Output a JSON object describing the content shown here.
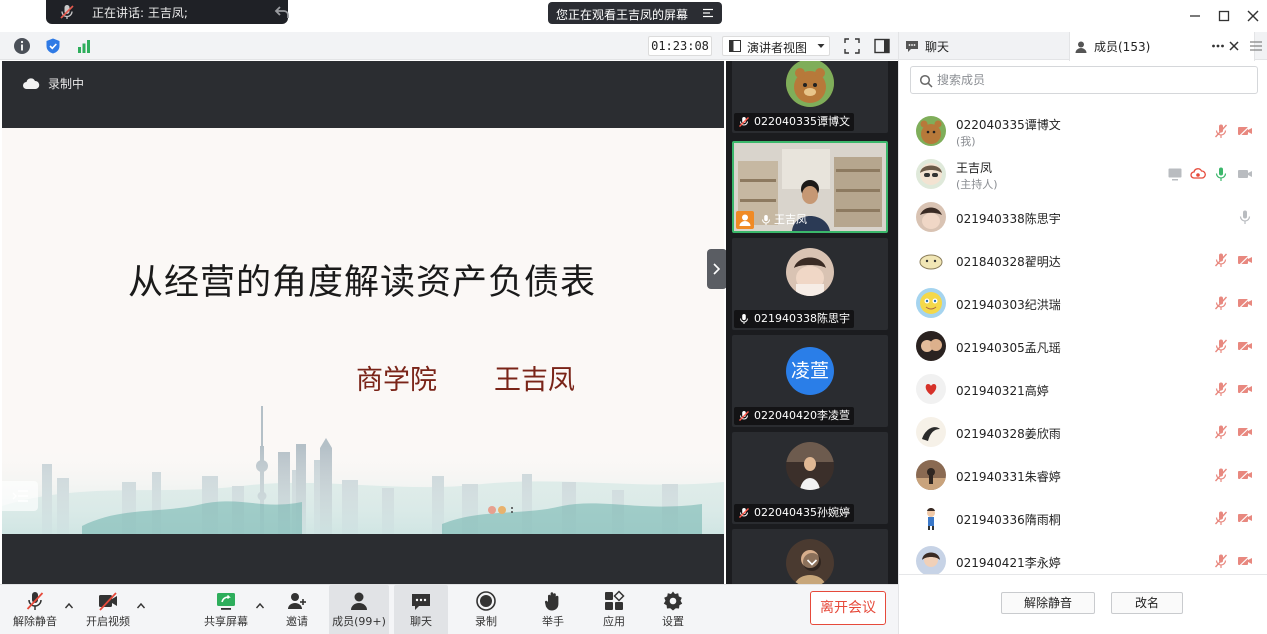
{
  "titlebar": {
    "speaking_text": "正在讲话: 王吉凤;",
    "watching_text": "您正在观看王吉凤的屏幕"
  },
  "toolbar": {
    "timer": "01:23:08",
    "view_mode": "演讲者视图"
  },
  "share": {
    "recording_label": "录制中",
    "slide_title": "从经营的角度解读资产负债表",
    "slide_school": "商学院",
    "slide_author": "王吉凤"
  },
  "tiles": [
    {
      "name": "022040335谭博文"
    },
    {
      "name": "王吉凤"
    },
    {
      "name": "021940338陈思宇"
    },
    {
      "name": "022040420李凌萱",
      "avatar_text": "凌萱"
    },
    {
      "name": "022040435孙婉婷"
    }
  ],
  "controls": {
    "unmute": "解除静音",
    "start_video": "开启视频",
    "share_screen": "共享屏幕",
    "invite": "邀请",
    "members": "成员(99+)",
    "chat": "聊天",
    "record": "录制",
    "raise_hand": "举手",
    "apps": "应用",
    "settings": "设置",
    "leave": "离开会议"
  },
  "panel": {
    "tab_chat": "聊天",
    "tab_members": "成员(153)",
    "search_placeholder": "搜索成员",
    "members": [
      {
        "name": "022040335谭博文",
        "sub": "(我)"
      },
      {
        "name": "王吉凤",
        "sub": "(主持人)"
      },
      {
        "name": "021940338陈思宇"
      },
      {
        "name": "021840328翟明达"
      },
      {
        "name": "021940303纪洪瑞"
      },
      {
        "name": "021940305孟凡瑶"
      },
      {
        "name": "021940321高婷"
      },
      {
        "name": "021940328姜欣雨"
      },
      {
        "name": "021940331朱睿婷"
      },
      {
        "name": "021940336隋雨桐"
      },
      {
        "name": "021940421李永婷"
      }
    ],
    "btn_unmute": "解除静音",
    "btn_rename": "改名"
  },
  "colors": {
    "accent_green": "#3bb76b",
    "muted_red": "#e8887f",
    "leave_red": "#e64a3b",
    "avatar_blue": "#2a7ee8"
  }
}
